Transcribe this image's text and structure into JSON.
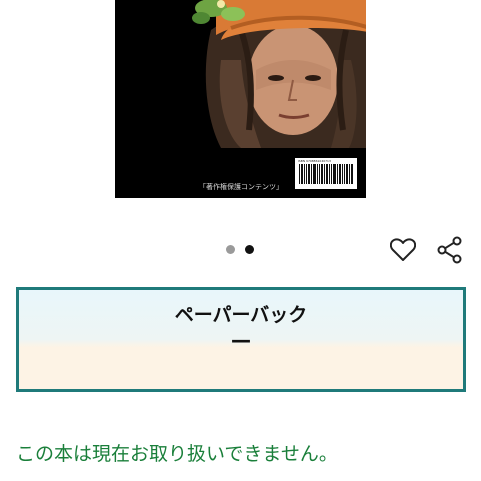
{
  "product_image": {
    "copyright_text": "「著作権保護コンテンツ」",
    "isbn_text": "ISBN 9798861040713"
  },
  "carousel": {
    "dots_count": 2,
    "active_index": 1
  },
  "actions": {
    "wishlist_icon": "heart-icon",
    "share_icon": "share-icon"
  },
  "format": {
    "label": "ペーパーバック",
    "price": "—",
    "border_color": "#1f7a7a"
  },
  "availability": {
    "text": "この本は現在お取り扱いできません。",
    "color": "#1a7f3a"
  }
}
